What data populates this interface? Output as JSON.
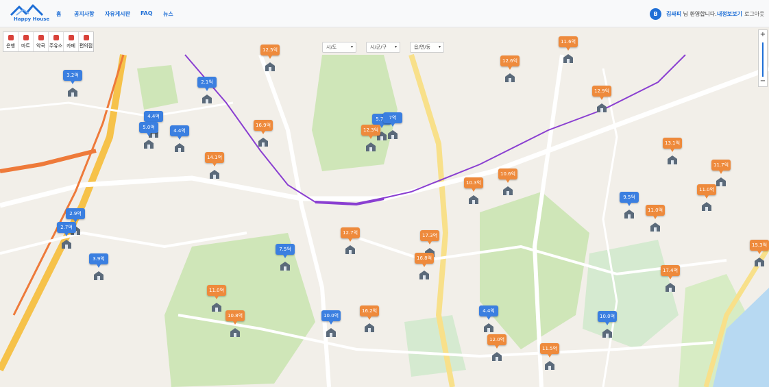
{
  "navbar": {
    "logo_text": "Happy House",
    "links": [
      {
        "label": "홈"
      },
      {
        "label": "공지사항"
      },
      {
        "label": "자유게시판"
      },
      {
        "label": "FAQ"
      },
      {
        "label": "뉴스"
      }
    ],
    "avatar_initial": "B",
    "username": "김싸피",
    "welcome_suffix": " 님 환영합니다.",
    "mypage_label": "내정보보기",
    "logout_label": "로그아웃"
  },
  "categories": [
    {
      "label": "은행",
      "icon": "bank-icon"
    },
    {
      "label": "마트",
      "icon": "cart-icon"
    },
    {
      "label": "약국",
      "icon": "pharmacy-icon"
    },
    {
      "label": "주유소",
      "icon": "gas-station-icon"
    },
    {
      "label": "카페",
      "icon": "cafe-icon"
    },
    {
      "label": "편의점",
      "icon": "convenience-store-icon"
    }
  ],
  "filters": {
    "sido": "시/도",
    "gugun": "시/군/구",
    "dong": "읍/면/동"
  },
  "zoom": {
    "plus": "+",
    "minus": "−"
  },
  "colors": {
    "accent": "#1f6fd6",
    "marker_blue": "#3b7fe0",
    "marker_orange": "#ee8a3c",
    "route": "#8a3fd1"
  },
  "markers": [
    {
      "price": "12.5억",
      "color": "orange"
    },
    {
      "price": "2.1억",
      "color": "blue"
    },
    {
      "price": "3.2억",
      "color": "blue"
    },
    {
      "price": "4.4억",
      "color": "blue"
    },
    {
      "price": "5.0억",
      "color": "blue"
    },
    {
      "price": "4.4억",
      "color": "blue"
    },
    {
      "price": "16.9억",
      "color": "orange"
    },
    {
      "price": "14.1억",
      "color": "orange"
    },
    {
      "price": "2.9억",
      "color": "blue"
    },
    {
      "price": "2.7억",
      "color": "blue"
    },
    {
      "price": "3.9억",
      "color": "blue"
    },
    {
      "price": "7.5억",
      "color": "blue"
    },
    {
      "price": "12.7억",
      "color": "orange"
    },
    {
      "price": "11.0억",
      "color": "orange"
    },
    {
      "price": "10.8억",
      "color": "orange"
    },
    {
      "price": "10.0억",
      "color": "blue"
    },
    {
      "price": "16.2억",
      "color": "orange"
    },
    {
      "price": "5.7억",
      "color": "blue"
    },
    {
      "price": "7억",
      "color": "blue"
    },
    {
      "price": "12.3억",
      "color": "orange"
    },
    {
      "price": "17.3억",
      "color": "orange"
    },
    {
      "price": "16.8억",
      "color": "orange"
    },
    {
      "price": "10.3억",
      "color": "orange"
    },
    {
      "price": "10.6억",
      "color": "orange"
    },
    {
      "price": "12.6억",
      "color": "orange"
    },
    {
      "price": "11.6억",
      "color": "orange"
    },
    {
      "price": "12.9억",
      "color": "orange"
    },
    {
      "price": "9.5억",
      "color": "blue"
    },
    {
      "price": "11.0억",
      "color": "orange"
    },
    {
      "price": "11.0억",
      "color": "orange"
    },
    {
      "price": "13.1억",
      "color": "orange"
    },
    {
      "price": "11.7억",
      "color": "orange"
    },
    {
      "price": "15.3억",
      "color": "orange"
    },
    {
      "price": "17.4억",
      "color": "orange"
    },
    {
      "price": "4.4억",
      "color": "blue"
    },
    {
      "price": "10.0억",
      "color": "blue"
    },
    {
      "price": "12.0억",
      "color": "orange"
    },
    {
      "price": "11.5억",
      "color": "orange"
    }
  ]
}
